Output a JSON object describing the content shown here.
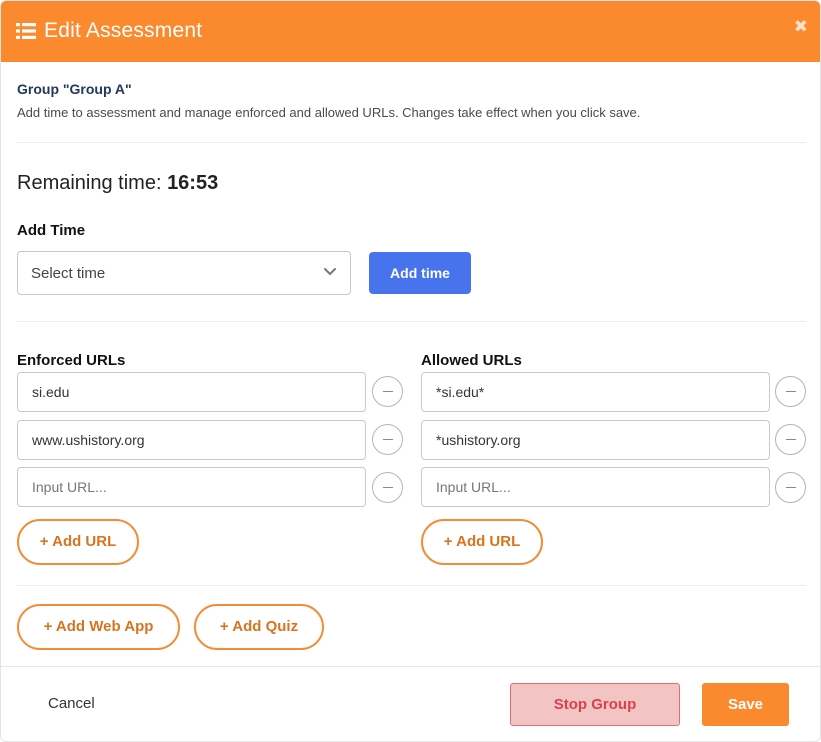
{
  "header": {
    "title": "Edit Assessment",
    "icon": "list-icon",
    "close_glyph": "✖",
    "color": "#fb8a2e"
  },
  "group": {
    "title": "Group \"Group A\"",
    "description": "Add time to assessment and manage enforced and allowed URLs. Changes take effect when you click save."
  },
  "remaining": {
    "label": "Remaining time: ",
    "value": "16:53"
  },
  "add_time": {
    "label": "Add Time",
    "select_value": "Select time",
    "button_label": "Add time"
  },
  "enforced": {
    "label": "Enforced URLs",
    "urls": [
      "si.edu",
      "www.ushistory.org"
    ],
    "placeholder": "Input URL...",
    "add_label": "+ Add URL"
  },
  "allowed": {
    "label": "Allowed URLs",
    "urls": [
      "*si.edu*",
      "*ushistory.org"
    ],
    "placeholder": "Input URL...",
    "add_label": "+ Add URL"
  },
  "extras": {
    "add_web_app": "+ Add Web App",
    "add_quiz": "+ Add Quiz"
  },
  "footer": {
    "cancel": "Cancel",
    "stop_group": "Stop Group",
    "save": "Save"
  }
}
